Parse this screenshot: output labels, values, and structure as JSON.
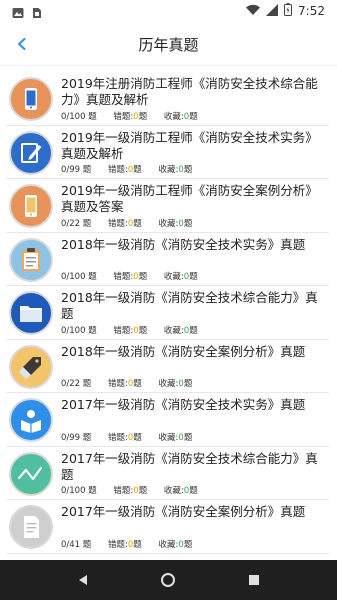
{
  "status": {
    "time": "7:52",
    "left_icons": [
      "photo-icon",
      "sim-card-icon"
    ],
    "right_icons": [
      "wifi-icon",
      "cell-signal-icon",
      "battery-icon"
    ]
  },
  "header": {
    "title": "历年真题",
    "back_icon": "chevron-left-icon",
    "accent": "#2a8fe6"
  },
  "labels": {
    "errors": "错题:",
    "favorites": "收藏:",
    "unit": "题"
  },
  "items": [
    {
      "title": "2019年注册消防工程师《消防安全技术综合能力》真题及解析",
      "progress": "0/100 题",
      "errors": "0",
      "favorites": "0",
      "icon": "phone-icon",
      "icon_color": "#e8935a"
    },
    {
      "title": "2019年一级消防工程师《消防安全技术实务》真题及解析",
      "progress": "0/99 题",
      "errors": "0",
      "favorites": "0",
      "icon": "edit-icon",
      "icon_color": "#2e6dc9"
    },
    {
      "title": "2019年一级消防工程师《消防安全案例分析》真题及答案",
      "progress": "0/22 题",
      "errors": "0",
      "favorites": "0",
      "icon": "phone-icon",
      "icon_color": "#e8935a"
    },
    {
      "title": "2018年一级消防《消防安全技术实务》真题",
      "progress": "0/100 题",
      "errors": "0",
      "favorites": "0",
      "icon": "clipboard-icon",
      "icon_color": "#8fc3e6"
    },
    {
      "title": "2018年一级消防《消防安全技术综合能力》真题",
      "progress": "0/100 题",
      "errors": "0",
      "favorites": "0",
      "icon": "folder-icon",
      "icon_color": "#1e5bb8"
    },
    {
      "title": "2018年一级消防《消防安全案例分析》真题",
      "progress": "0/22 题",
      "errors": "0",
      "favorites": "0",
      "icon": "tag-icon",
      "icon_color": "#f2c56b"
    },
    {
      "title": "2017年一级消防《消防安全技术实务》真题",
      "progress": "0/99 题",
      "errors": "0",
      "favorites": "0",
      "icon": "reader-icon",
      "icon_color": "#2f8ee8"
    },
    {
      "title": "2017年一级消防《消防安全技术综合能力》真题",
      "progress": "0/100 题",
      "errors": "0",
      "favorites": "0",
      "icon": "chart-line-icon",
      "icon_color": "#4fbfa0"
    },
    {
      "title": "2017年一级消防《消防安全案例分析》真题",
      "progress": "0/41 题",
      "errors": "0",
      "favorites": "0",
      "icon": "document-icon",
      "icon_color": "#cfcfcf"
    }
  ],
  "nav": {
    "back_icon": "triangle-back-icon",
    "home_icon": "circle-home-icon",
    "recents_icon": "square-recents-icon"
  }
}
